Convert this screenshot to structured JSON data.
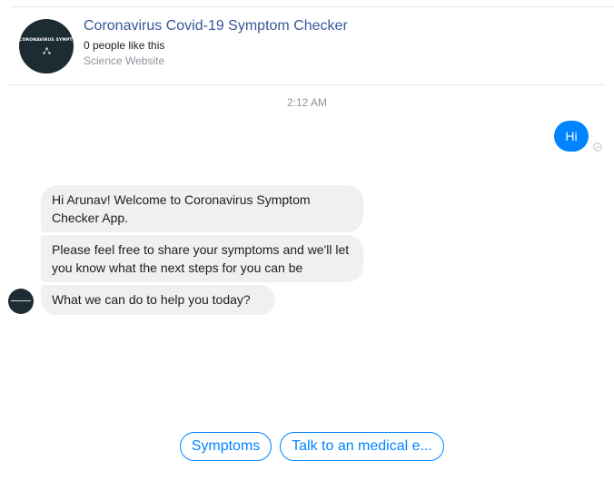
{
  "header": {
    "title": "Coronavirus Covid-19 Symptom Checker",
    "likes": "0 people like this",
    "category": "Science Website",
    "avatar_text": "CORONAVIRUS SYMPTOM CHECKER"
  },
  "conversation": {
    "timestamp": "2:12 AM",
    "outgoing": [
      {
        "text": "Hi"
      }
    ],
    "incoming": [
      {
        "text": "Hi Arunav! Welcome to Coronavirus Symptom Checker App."
      },
      {
        "text": "Please feel free to share your symptoms and we'll let you know what the next steps for you can be"
      },
      {
        "text": "What we can do to help you today?"
      }
    ]
  },
  "quick_replies": [
    {
      "label": "Symptoms"
    },
    {
      "label": "Talk to an medical e..."
    }
  ],
  "colors": {
    "accent": "#0084ff",
    "title_link": "#385898",
    "bubble_in": "#f1f0f0",
    "muted": "#90949c",
    "avatar_bg": "#1d2b32"
  },
  "icons": {
    "seen": "seen-check-icon",
    "page_logo": "page-logo-icon"
  }
}
